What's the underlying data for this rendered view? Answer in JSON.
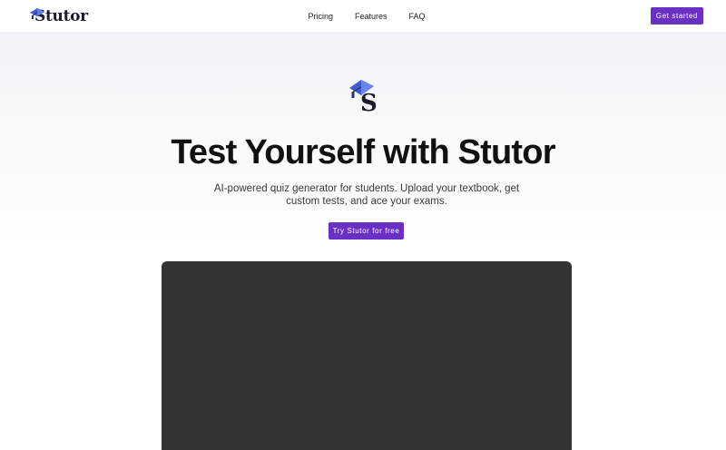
{
  "nav": {
    "logo_text": "Stutor",
    "links": [
      "Pricing",
      "Features",
      "FAQ"
    ],
    "cta_label": "Get started"
  },
  "hero": {
    "title": "Test Yourself with Stutor",
    "subtitle": "AI-powered quiz generator for students. Upload your textbook, get custom tests, and ace your exams.",
    "cta_label": "Try Stutor for free",
    "icon": "graduation-cap-icon"
  },
  "colors": {
    "accent": "#6a30c4",
    "logo_cap": "#3f5ccf",
    "video_bg": "#333333"
  }
}
